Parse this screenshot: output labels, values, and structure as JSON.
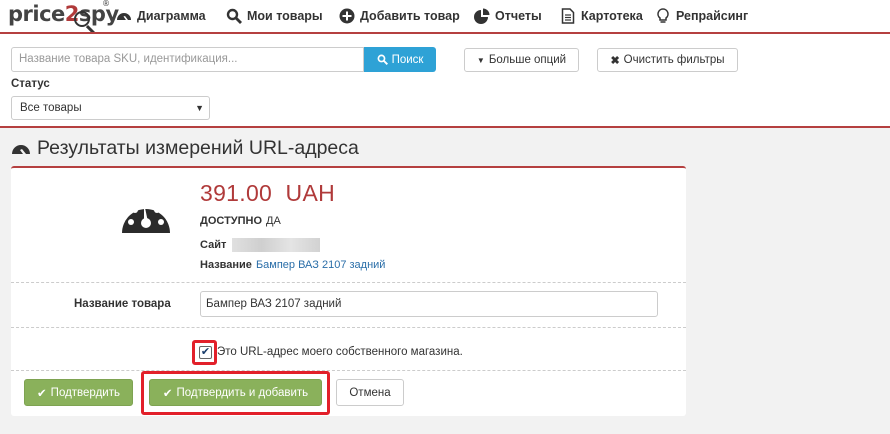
{
  "nav": {
    "logo": {
      "part1": "price",
      "part2": "2",
      "part3": "spy",
      "reg": "®"
    },
    "items": [
      {
        "label": "Диаграмма",
        "icon": "dashboard-icon"
      },
      {
        "label": "Мои товары",
        "icon": "search-icon"
      },
      {
        "label": "Добавить товар",
        "icon": "plus-circle-icon"
      },
      {
        "label": "Отчеты",
        "icon": "pie-chart-icon"
      },
      {
        "label": "Картотека",
        "icon": "document-icon"
      },
      {
        "label": "Репрайсинг",
        "icon": "lightbulb-icon"
      }
    ]
  },
  "filters": {
    "search_placeholder": "Название товара SKU, идентификация...",
    "search_button": "Поиск",
    "more_options": "Больше опций",
    "clear_filters": "Очистить фильтры",
    "status_label": "Статус",
    "status_value": "Все товары"
  },
  "page": {
    "title": "Результаты измерений URL-адреса"
  },
  "result": {
    "price": "391.00",
    "currency": "UAH",
    "available_label": "ДОСТУПНО",
    "available_value": "ДА",
    "site_label": "Сайт",
    "name_label": "Название",
    "name_value": "Бампер ВАЗ 2107 задний"
  },
  "form": {
    "product_name_label": "Название товара",
    "product_name_value": "Бампер ВАЗ 2107 задний",
    "own_store_label": "Это URL-адрес моего собственного магазина.",
    "own_store_checked": true,
    "confirm": "Подтвердить",
    "confirm_add": "Подтвердить и добавить",
    "cancel": "Отмена"
  },
  "colors": {
    "accent": "#b54040",
    "primary_blue": "#2ea2d6",
    "success_green": "#8ab15b",
    "highlight_red": "#e2202a",
    "price_red": "#b03a3a"
  }
}
